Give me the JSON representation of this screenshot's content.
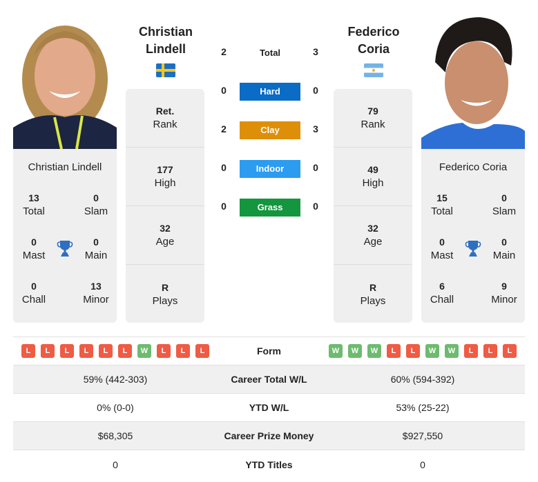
{
  "player1": {
    "name_line1": "Christian",
    "name_line2": "Lindell",
    "full_name": "Christian Lindell",
    "country": "Sweden",
    "flag_icon": "sweden-flag-icon",
    "stats": [
      {
        "value": "Ret.",
        "label": "Rank"
      },
      {
        "value": "177",
        "label": "High"
      },
      {
        "value": "32",
        "label": "Age"
      },
      {
        "value": "R",
        "label": "Plays"
      }
    ],
    "titles": {
      "total": {
        "value": "13",
        "label": "Total"
      },
      "slam": {
        "value": "0",
        "label": "Slam"
      },
      "mast": {
        "value": "0",
        "label": "Mast"
      },
      "main": {
        "value": "0",
        "label": "Main"
      },
      "chall": {
        "value": "0",
        "label": "Chall"
      },
      "minor": {
        "value": "13",
        "label": "Minor"
      }
    },
    "form": [
      "L",
      "L",
      "L",
      "L",
      "L",
      "L",
      "W",
      "L",
      "L",
      "L"
    ]
  },
  "player2": {
    "name_line1": "Federico",
    "name_line2": "Coria",
    "full_name": "Federico Coria",
    "country": "Argentina",
    "flag_icon": "argentina-flag-icon",
    "stats": [
      {
        "value": "79",
        "label": "Rank"
      },
      {
        "value": "49",
        "label": "High"
      },
      {
        "value": "32",
        "label": "Age"
      },
      {
        "value": "R",
        "label": "Plays"
      }
    ],
    "titles": {
      "total": {
        "value": "15",
        "label": "Total"
      },
      "slam": {
        "value": "0",
        "label": "Slam"
      },
      "mast": {
        "value": "0",
        "label": "Mast"
      },
      "main": {
        "value": "0",
        "label": "Main"
      },
      "chall": {
        "value": "6",
        "label": "Chall"
      },
      "minor": {
        "value": "9",
        "label": "Minor"
      }
    },
    "form": [
      "W",
      "W",
      "W",
      "L",
      "L",
      "W",
      "W",
      "L",
      "L",
      "L"
    ]
  },
  "h2h": {
    "total": {
      "label": "Total",
      "p1": "2",
      "p2": "3"
    },
    "surfaces": [
      {
        "label": "Hard",
        "p1": "0",
        "p2": "0",
        "color": "#0a6cc4"
      },
      {
        "label": "Clay",
        "p1": "2",
        "p2": "3",
        "color": "#de8f0a"
      },
      {
        "label": "Indoor",
        "p1": "0",
        "p2": "0",
        "color": "#2b9cf0"
      },
      {
        "label": "Grass",
        "p1": "0",
        "p2": "0",
        "color": "#13963d"
      }
    ]
  },
  "comparison": {
    "form_label": "Form",
    "rows": [
      {
        "label": "Career Total W/L",
        "p1": "59% (442-303)",
        "p2": "60% (594-392)"
      },
      {
        "label": "YTD W/L",
        "p1": "0% (0-0)",
        "p2": "53% (25-22)"
      },
      {
        "label": "Career Prize Money",
        "p1": "$68,305",
        "p2": "$927,550"
      },
      {
        "label": "YTD Titles",
        "p1": "0",
        "p2": "0"
      }
    ]
  },
  "colors": {
    "win": "#6dbb6f",
    "loss": "#ef5b44",
    "trophy": "#2f6fbf"
  }
}
